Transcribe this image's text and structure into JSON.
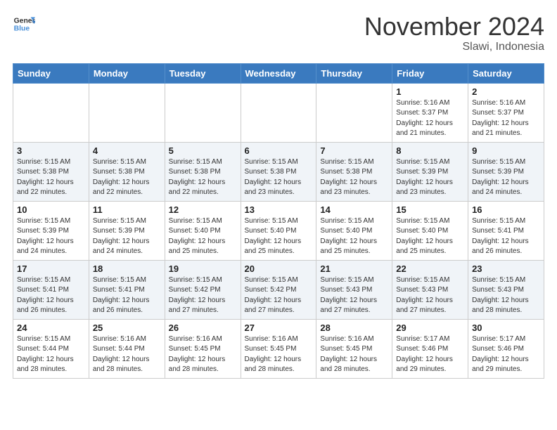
{
  "header": {
    "logo_line1": "General",
    "logo_line2": "Blue",
    "title": "November 2024",
    "subtitle": "Slawi, Indonesia"
  },
  "weekdays": [
    "Sunday",
    "Monday",
    "Tuesday",
    "Wednesday",
    "Thursday",
    "Friday",
    "Saturday"
  ],
  "weeks": [
    [
      {
        "day": "",
        "info": ""
      },
      {
        "day": "",
        "info": ""
      },
      {
        "day": "",
        "info": ""
      },
      {
        "day": "",
        "info": ""
      },
      {
        "day": "",
        "info": ""
      },
      {
        "day": "1",
        "info": "Sunrise: 5:16 AM\nSunset: 5:37 PM\nDaylight: 12 hours\nand 21 minutes."
      },
      {
        "day": "2",
        "info": "Sunrise: 5:16 AM\nSunset: 5:37 PM\nDaylight: 12 hours\nand 21 minutes."
      }
    ],
    [
      {
        "day": "3",
        "info": "Sunrise: 5:15 AM\nSunset: 5:38 PM\nDaylight: 12 hours\nand 22 minutes."
      },
      {
        "day": "4",
        "info": "Sunrise: 5:15 AM\nSunset: 5:38 PM\nDaylight: 12 hours\nand 22 minutes."
      },
      {
        "day": "5",
        "info": "Sunrise: 5:15 AM\nSunset: 5:38 PM\nDaylight: 12 hours\nand 22 minutes."
      },
      {
        "day": "6",
        "info": "Sunrise: 5:15 AM\nSunset: 5:38 PM\nDaylight: 12 hours\nand 23 minutes."
      },
      {
        "day": "7",
        "info": "Sunrise: 5:15 AM\nSunset: 5:38 PM\nDaylight: 12 hours\nand 23 minutes."
      },
      {
        "day": "8",
        "info": "Sunrise: 5:15 AM\nSunset: 5:39 PM\nDaylight: 12 hours\nand 23 minutes."
      },
      {
        "day": "9",
        "info": "Sunrise: 5:15 AM\nSunset: 5:39 PM\nDaylight: 12 hours\nand 24 minutes."
      }
    ],
    [
      {
        "day": "10",
        "info": "Sunrise: 5:15 AM\nSunset: 5:39 PM\nDaylight: 12 hours\nand 24 minutes."
      },
      {
        "day": "11",
        "info": "Sunrise: 5:15 AM\nSunset: 5:39 PM\nDaylight: 12 hours\nand 24 minutes."
      },
      {
        "day": "12",
        "info": "Sunrise: 5:15 AM\nSunset: 5:40 PM\nDaylight: 12 hours\nand 25 minutes."
      },
      {
        "day": "13",
        "info": "Sunrise: 5:15 AM\nSunset: 5:40 PM\nDaylight: 12 hours\nand 25 minutes."
      },
      {
        "day": "14",
        "info": "Sunrise: 5:15 AM\nSunset: 5:40 PM\nDaylight: 12 hours\nand 25 minutes."
      },
      {
        "day": "15",
        "info": "Sunrise: 5:15 AM\nSunset: 5:40 PM\nDaylight: 12 hours\nand 25 minutes."
      },
      {
        "day": "16",
        "info": "Sunrise: 5:15 AM\nSunset: 5:41 PM\nDaylight: 12 hours\nand 26 minutes."
      }
    ],
    [
      {
        "day": "17",
        "info": "Sunrise: 5:15 AM\nSunset: 5:41 PM\nDaylight: 12 hours\nand 26 minutes."
      },
      {
        "day": "18",
        "info": "Sunrise: 5:15 AM\nSunset: 5:41 PM\nDaylight: 12 hours\nand 26 minutes."
      },
      {
        "day": "19",
        "info": "Sunrise: 5:15 AM\nSunset: 5:42 PM\nDaylight: 12 hours\nand 27 minutes."
      },
      {
        "day": "20",
        "info": "Sunrise: 5:15 AM\nSunset: 5:42 PM\nDaylight: 12 hours\nand 27 minutes."
      },
      {
        "day": "21",
        "info": "Sunrise: 5:15 AM\nSunset: 5:43 PM\nDaylight: 12 hours\nand 27 minutes."
      },
      {
        "day": "22",
        "info": "Sunrise: 5:15 AM\nSunset: 5:43 PM\nDaylight: 12 hours\nand 27 minutes."
      },
      {
        "day": "23",
        "info": "Sunrise: 5:15 AM\nSunset: 5:43 PM\nDaylight: 12 hours\nand 28 minutes."
      }
    ],
    [
      {
        "day": "24",
        "info": "Sunrise: 5:15 AM\nSunset: 5:44 PM\nDaylight: 12 hours\nand 28 minutes."
      },
      {
        "day": "25",
        "info": "Sunrise: 5:16 AM\nSunset: 5:44 PM\nDaylight: 12 hours\nand 28 minutes."
      },
      {
        "day": "26",
        "info": "Sunrise: 5:16 AM\nSunset: 5:45 PM\nDaylight: 12 hours\nand 28 minutes."
      },
      {
        "day": "27",
        "info": "Sunrise: 5:16 AM\nSunset: 5:45 PM\nDaylight: 12 hours\nand 28 minutes."
      },
      {
        "day": "28",
        "info": "Sunrise: 5:16 AM\nSunset: 5:45 PM\nDaylight: 12 hours\nand 28 minutes."
      },
      {
        "day": "29",
        "info": "Sunrise: 5:17 AM\nSunset: 5:46 PM\nDaylight: 12 hours\nand 29 minutes."
      },
      {
        "day": "30",
        "info": "Sunrise: 5:17 AM\nSunset: 5:46 PM\nDaylight: 12 hours\nand 29 minutes."
      }
    ]
  ]
}
